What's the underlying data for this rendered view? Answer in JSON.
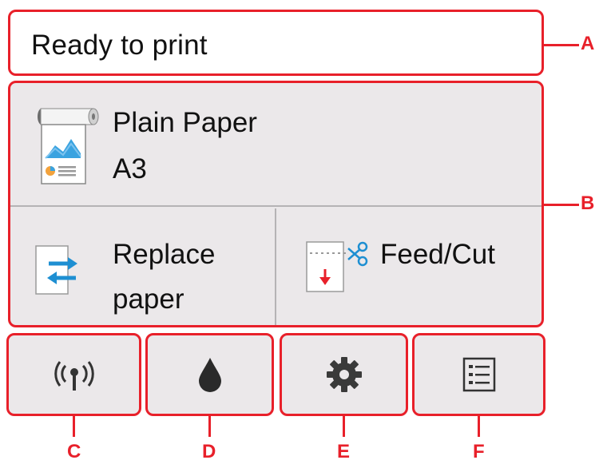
{
  "status": {
    "message": "Ready to print"
  },
  "media": {
    "paper_type": "Plain Paper",
    "paper_size": "A3"
  },
  "actions": {
    "replace_paper": {
      "line1": "Replace",
      "line2": "paper"
    },
    "feed_cut": {
      "label": "Feed/Cut"
    }
  },
  "bottom_tiles": [
    {
      "icon": "wireless-icon"
    },
    {
      "icon": "ink-drop-icon"
    },
    {
      "icon": "gear-icon"
    },
    {
      "icon": "menu-list-icon"
    }
  ],
  "callouts": {
    "a": "A",
    "b": "B",
    "c": "C",
    "d": "D",
    "e": "E",
    "f": "F"
  },
  "colors": {
    "accent": "#e8202a",
    "panel_bg": "#ebe8ea",
    "icon_blue": "#1e8fd2",
    "icon_dark": "#333333"
  }
}
